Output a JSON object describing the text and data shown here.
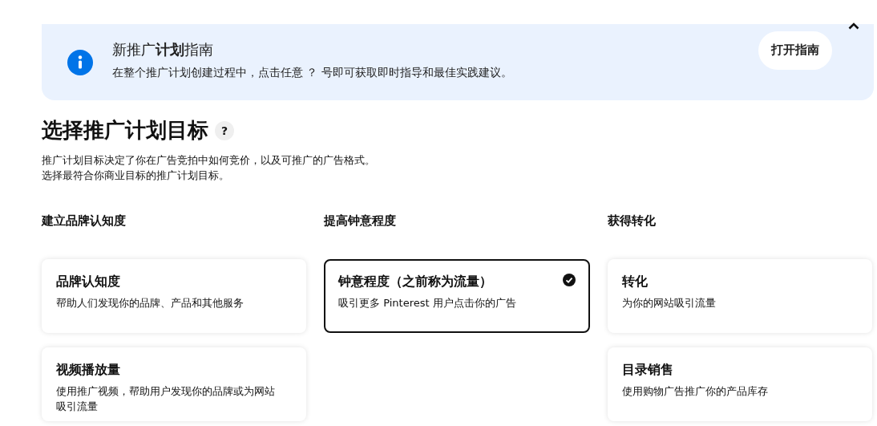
{
  "guide_banner": {
    "title": "新推广**计划**指南",
    "text": "在整个推广计划创建过程中，点击任意 ？ 号即可获取即时指导和最佳实践建议。",
    "button": "打开指南"
  },
  "objective": {
    "heading": "选择推广计划目标",
    "help": "?",
    "description": [
      "推广计划目标决定了你在广告竞拍中如何竞价，以及可推广的广告格式。",
      "选择最符合你商业目标的推广计划目标。"
    ]
  },
  "columns": [
    {
      "title": "建立品牌认知度",
      "options": [
        {
          "title": "品牌认知度",
          "text": "帮助人们发现你的品牌、产品和其他服务",
          "selected": false
        },
        {
          "title": "视频播放量",
          "text": "使用推广视频，帮助用户发现你的品牌或为网站吸引流量",
          "selected": false
        }
      ]
    },
    {
      "title": "提高钟意程度",
      "options": [
        {
          "title": "钟意程度（之前称为流量）",
          "text": "吸引更多 Pinterest 用户点击你的广告",
          "selected": true
        }
      ]
    },
    {
      "title": "获得转化",
      "options": [
        {
          "title": "转化",
          "text": "为你的网站吸引流量",
          "selected": false
        },
        {
          "title": "目录销售",
          "text": "使用购物广告推广你的产品库存",
          "selected": false
        }
      ]
    }
  ]
}
